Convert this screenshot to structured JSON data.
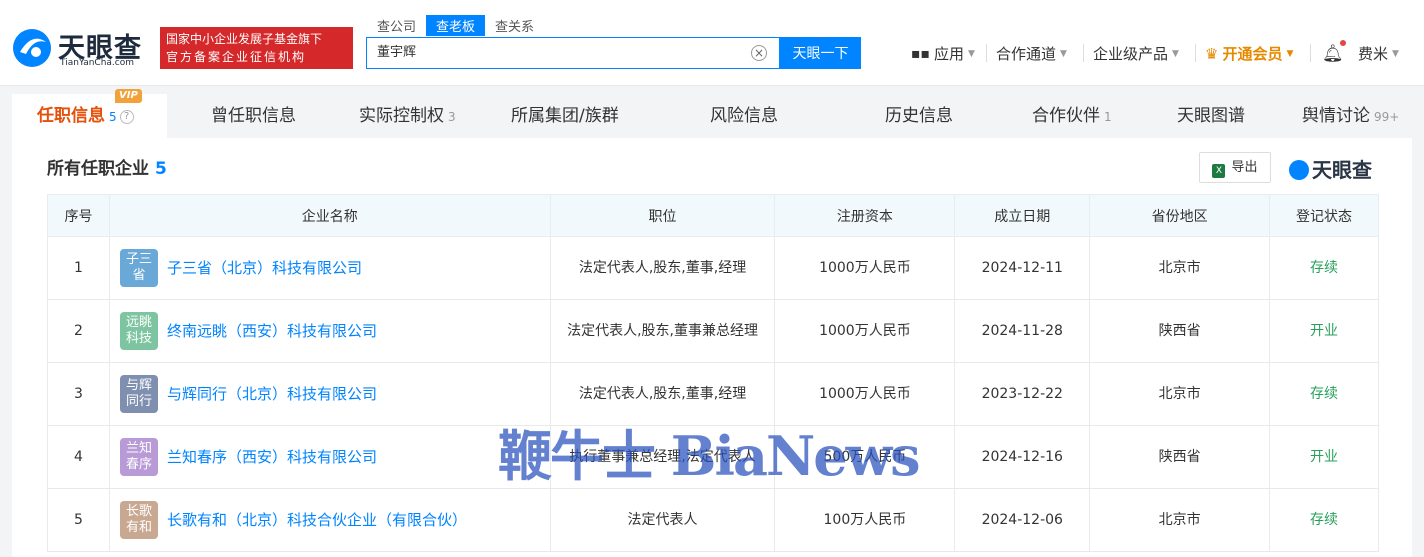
{
  "header": {
    "logo_name": "天眼查",
    "logo_url": "TianYanCha.com",
    "banner_line1": "国家中小企业发展子基金旗下",
    "banner_line2": "官方备案企业征信机构",
    "search_tabs": [
      "查公司",
      "查老板",
      "查关系"
    ],
    "search_value": "董宇辉",
    "search_button": "天眼一下",
    "nav": {
      "apps": "应用",
      "partner_channel": "合作通道",
      "enterprise_products": "企业级产品",
      "vip": "开通会员",
      "user": "费米"
    }
  },
  "tabs": [
    {
      "label": "任职信息",
      "count": "5",
      "vip": "VIP"
    },
    {
      "label": "曾任职信息",
      "count": ""
    },
    {
      "label": "实际控制权",
      "count": "3"
    },
    {
      "label": "所属集团/族群",
      "count": ""
    },
    {
      "label": "风险信息",
      "count": ""
    },
    {
      "label": "历史信息",
      "count": ""
    },
    {
      "label": "合作伙伴",
      "count": "1"
    },
    {
      "label": "天眼图谱",
      "count": ""
    },
    {
      "label": "舆情讨论",
      "count": "99+"
    }
  ],
  "section": {
    "title": "所有任职企业",
    "count": "5",
    "export_label": "导出",
    "brand": "天眼查"
  },
  "table": {
    "headers": [
      "序号",
      "企业名称",
      "职位",
      "注册资本",
      "成立日期",
      "省份地区",
      "登记状态"
    ],
    "rows": [
      {
        "no": "1",
        "logo": "子三省",
        "logo_color": "#6aa8d8",
        "name": "子三省（北京）科技有限公司",
        "position": "法定代表人,股东,董事,经理",
        "capital": "1000万人民币",
        "date": "2024-12-11",
        "region": "北京市",
        "status": "存续"
      },
      {
        "no": "2",
        "logo": "远眺科技",
        "logo_color": "#7dc5a0",
        "name": "终南远眺（西安）科技有限公司",
        "position": "法定代表人,股东,董事兼总经理",
        "capital": "1000万人民币",
        "date": "2024-11-28",
        "region": "陕西省",
        "status": "开业"
      },
      {
        "no": "3",
        "logo": "与辉同行",
        "logo_color": "#7f8fb0",
        "name": "与辉同行（北京）科技有限公司",
        "position": "法定代表人,股东,董事,经理",
        "capital": "1000万人民币",
        "date": "2023-12-22",
        "region": "北京市",
        "status": "存续"
      },
      {
        "no": "4",
        "logo": "兰知春序",
        "logo_color": "#b79ad6",
        "name": "兰知春序（西安）科技有限公司",
        "position": "执行董事兼总经理,法定代表人",
        "capital": "500万人民币",
        "date": "2024-12-16",
        "region": "陕西省",
        "status": "开业"
      },
      {
        "no": "5",
        "logo": "长歌有和",
        "logo_color": "#c9a891",
        "name": "长歌有和（北京）科技合伙企业（有限合伙）",
        "position": "法定代表人",
        "capital": "100万人民币",
        "date": "2024-12-06",
        "region": "北京市",
        "status": "存续"
      }
    ]
  },
  "watermark": "鞭牛士 BiaNews"
}
